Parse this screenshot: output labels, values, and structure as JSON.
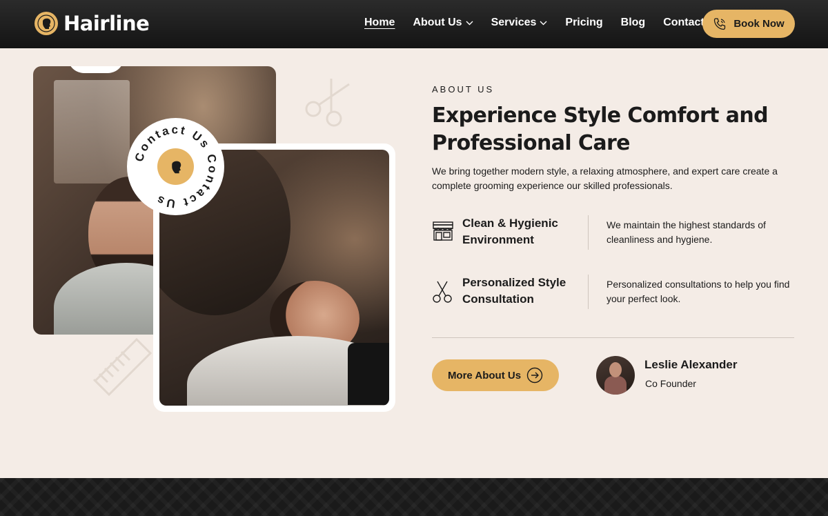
{
  "brand": {
    "name": "Hairline",
    "logo_icon": "barber-head-logo",
    "accent": "#e6b565"
  },
  "nav": {
    "items": [
      {
        "label": "Home",
        "active": true,
        "dropdown": false
      },
      {
        "label": "About Us",
        "active": false,
        "dropdown": true
      },
      {
        "label": "Services",
        "active": false,
        "dropdown": true
      },
      {
        "label": "Pricing",
        "active": false,
        "dropdown": false
      },
      {
        "label": "Blog",
        "active": false,
        "dropdown": false
      },
      {
        "label": "Contact",
        "active": false,
        "dropdown": false
      }
    ],
    "cta": {
      "label": "Book Now",
      "icon": "phone-icon"
    }
  },
  "badge": {
    "text": "Contact Us Contact Us "
  },
  "about": {
    "eyebrow": "ABOUT US",
    "title": "Experience Style Comfort and Professional Care",
    "intro": "We bring together modern style, a relaxing atmosphere, and expert care create a complete grooming experience our skilled professionals.",
    "features": [
      {
        "icon": "barber-shop-icon",
        "title": "Clean & Hygienic Environment",
        "desc": "We maintain the highest standards of cleanliness and hygiene."
      },
      {
        "icon": "scissors-icon",
        "title": "Personalized Style Consultation",
        "desc": "Personalized consultations to help you find your perfect look."
      }
    ],
    "button": {
      "label": "More About Us",
      "icon": "arrow-circle-right-icon"
    },
    "person": {
      "name": "Leslie Alexander",
      "role": "Co Founder"
    }
  }
}
